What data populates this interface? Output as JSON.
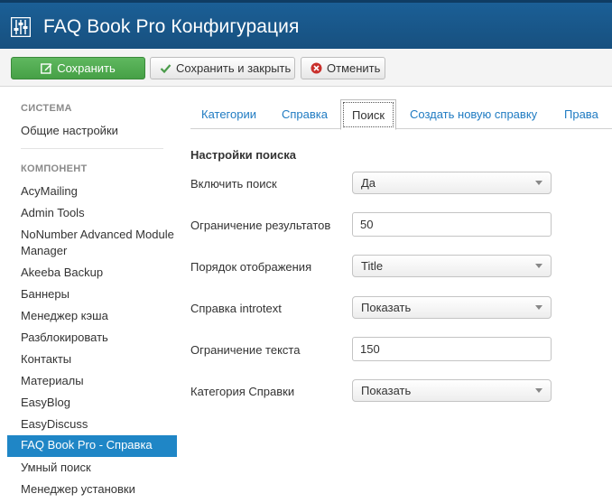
{
  "header": {
    "title": "FAQ Book Pro Конфигурация"
  },
  "toolbar": {
    "save_label": "Сохранить",
    "save_close_label": "Сохранить и закрыть",
    "cancel_label": "Отменить"
  },
  "sidebar": {
    "system_heading": "СИСТЕМА",
    "system_items": [
      "Общие настройки"
    ],
    "component_heading": "КОМПОНЕНТ",
    "component_items": [
      "AcyMailing",
      "Admin Tools",
      "NoNumber Advanced Module Manager",
      "Akeeba Backup",
      "Баннеры",
      "Менеджер кэша",
      "Разблокировать",
      "Контакты",
      "Материалы",
      "EasyBlog",
      "EasyDiscuss",
      "FAQ Book Pro - Справка",
      "Умный поиск",
      "Менеджер установки"
    ],
    "active_item": "FAQ Book Pro - Справка"
  },
  "tabs": [
    "Категории",
    "Справка",
    "Поиск",
    "Создать новую справку",
    "Права"
  ],
  "active_tab": "Поиск",
  "form": {
    "section_title": "Настройки поиска",
    "fields": [
      {
        "label": "Включить поиск",
        "type": "select",
        "value": "Да"
      },
      {
        "label": "Ограничение результатов",
        "type": "input",
        "value": "50"
      },
      {
        "label": "Порядок отображения",
        "type": "select",
        "value": "Title"
      },
      {
        "label": "Справка introtext",
        "type": "select",
        "value": "Показать"
      },
      {
        "label": "Ограничение текста",
        "type": "input",
        "value": "150"
      },
      {
        "label": "Категория Справки",
        "type": "select",
        "value": "Показать"
      }
    ]
  },
  "colors": {
    "header_bg": "#17507f",
    "save_button": "#46a046",
    "active_sidebar": "#1f86c6",
    "link": "#1f7bc2",
    "cancel_icon": "#c9302c"
  },
  "icons": {
    "app": "sliders-icon",
    "save": "edit-icon",
    "save_close": "check-icon",
    "cancel": "cancel-circle-icon"
  }
}
